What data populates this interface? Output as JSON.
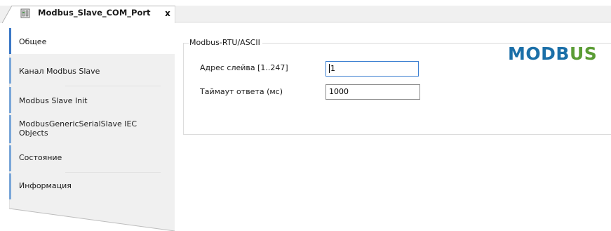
{
  "tab": {
    "title": "Modbus_Slave_COM_Port",
    "close_glyph": "x",
    "icon": "device-object-icon"
  },
  "nav": {
    "items": [
      {
        "label": "Общее",
        "active": true
      },
      {
        "label": "Канал Modbus Slave",
        "active": false
      },
      {
        "label": "Modbus Slave Init",
        "active": false
      },
      {
        "label_line1": "ModbusGenericSerialSlave IEC",
        "label_line2": "Objects",
        "active": false
      },
      {
        "label": "Состояние",
        "active": false
      },
      {
        "label": "Информация",
        "active": false
      }
    ]
  },
  "settings": {
    "group_title": "Modbus-RTU/ASCII",
    "slave_address": {
      "label": "Адрес слейва [1..247]",
      "value": "1"
    },
    "response_timeout": {
      "label": "Таймаут ответа (мс)",
      "value": "1000"
    }
  },
  "logo": {
    "part1": "MODB",
    "part2": "US",
    "colors": {
      "primary": "#1b6fa8",
      "secondary": "#5a9c34"
    }
  },
  "colors": {
    "accent": "#3b78c6",
    "nav_bg": "#f0f0f0",
    "nav_bar": "#7aa6d8",
    "focus_border": "#3c7fd1"
  }
}
